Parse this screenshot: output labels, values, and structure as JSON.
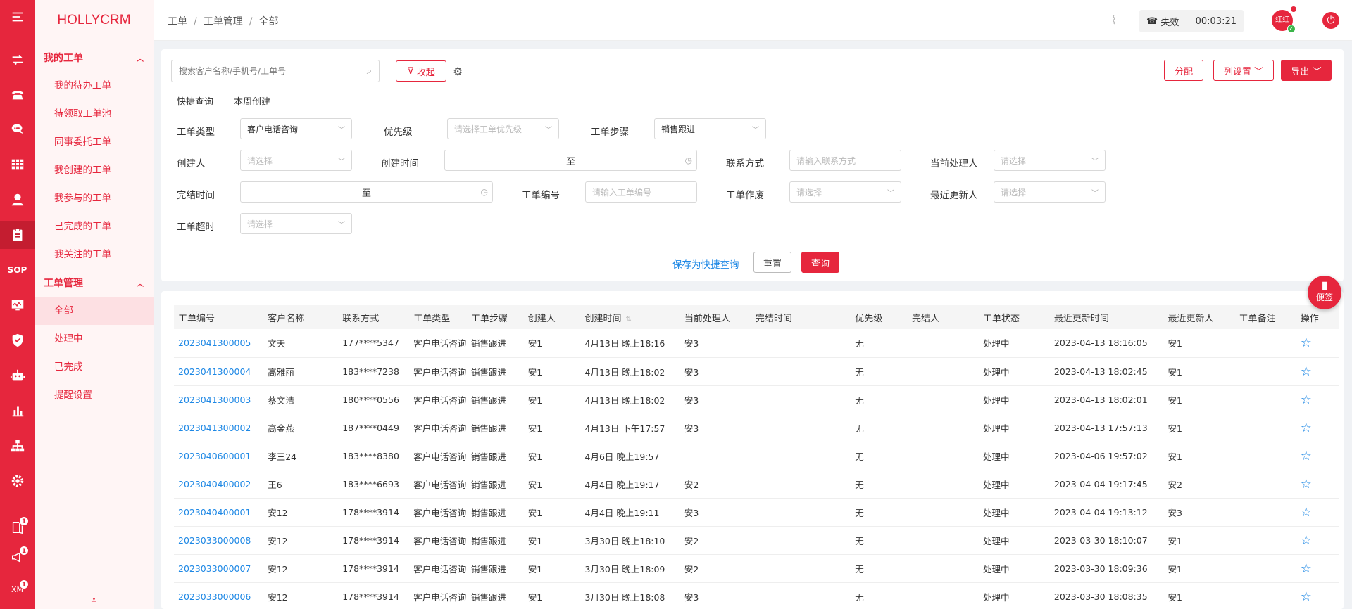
{
  "brand": "HOLLYCRM",
  "rail": {
    "items": [
      "menu-icon",
      "transfer-icon",
      "phone-icon",
      "chat-icon",
      "grid-icon",
      "user-icon",
      "clipboard-icon",
      "sop-text",
      "monitor-icon",
      "shield-icon",
      "robot-icon",
      "chart-icon",
      "org-icon",
      "gear-icon"
    ],
    "sop_label": "SOP",
    "bottom_badges": [
      "1",
      "1",
      "1"
    ],
    "xm_label": "XM"
  },
  "sidebar": {
    "group1": "我的工单",
    "group1_items": [
      "我的待办工单",
      "待领取工单池",
      "同事委托工单",
      "我创建的工单",
      "我参与的工单",
      "已完成的工单",
      "我关注的工单"
    ],
    "group2": "工单管理",
    "group2_items": [
      "全部",
      "处理中",
      "已完成",
      "提醒设置"
    ]
  },
  "topbar": {
    "breadcrumb": [
      "工单",
      "工单管理",
      "全部"
    ],
    "phone_status": "失效",
    "timer": "00:03:21",
    "avatar_text": "红红"
  },
  "filter": {
    "search_placeholder": "搜索客户名称/手机号/工单号",
    "collapse_label": "收起",
    "assign_label": "分配",
    "column_settings_label": "列设置",
    "export_label": "导出",
    "quick_query_label": "快捷查询",
    "quick_this_week": "本周创建",
    "labels": {
      "type": "工单类型",
      "priority": "优先级",
      "step": "工单步骤",
      "creator": "创建人",
      "created_time": "创建时间",
      "contact": "联系方式",
      "handler": "当前处理人",
      "finish_time": "完结时间",
      "number": "工单编号",
      "voided": "工单作废",
      "updater": "最近更新人",
      "overtime": "工单超时"
    },
    "values": {
      "type": "客户电话咨询",
      "priority_ph": "请选择工单优先级",
      "step": "销售跟进",
      "select_ph": "请选择",
      "contact_ph": "请输入联系方式",
      "number_ph": "请输入工单编号",
      "range_sep": "至"
    },
    "save_quick": "保存为快捷查询",
    "reset": "重置",
    "query": "查询"
  },
  "table": {
    "headers": [
      "工单编号",
      "客户名称",
      "联系方式",
      "工单类型",
      "工单步骤",
      "创建人",
      "创建时间",
      "当前处理人",
      "完结时间",
      "优先级",
      "完结人",
      "工单状态",
      "最近更新时间",
      "最近更新人",
      "工单备注",
      "操作"
    ],
    "rows": [
      [
        "2023041300005",
        "文天",
        "177****5347",
        "客户电话咨询",
        "销售跟进",
        "安1",
        "4月13日 晚上18:16",
        "安3",
        "",
        "无",
        "",
        "处理中",
        "2023-04-13 18:16:05",
        "安1",
        ""
      ],
      [
        "2023041300004",
        "高雅丽",
        "183****7238",
        "客户电话咨询",
        "销售跟进",
        "安1",
        "4月13日 晚上18:02",
        "安3",
        "",
        "无",
        "",
        "处理中",
        "2023-04-13 18:02:45",
        "安1",
        ""
      ],
      [
        "2023041300003",
        "蔡文浩",
        "180****0556",
        "客户电话咨询",
        "销售跟进",
        "安1",
        "4月13日 晚上18:02",
        "安3",
        "",
        "无",
        "",
        "处理中",
        "2023-04-13 18:02:01",
        "安1",
        ""
      ],
      [
        "2023041300002",
        "高金燕",
        "187****0449",
        "客户电话咨询",
        "销售跟进",
        "安1",
        "4月13日 下午17:57",
        "安3",
        "",
        "无",
        "",
        "处理中",
        "2023-04-13 17:57:13",
        "安1",
        ""
      ],
      [
        "2023040600001",
        "李三24",
        "183****8380",
        "客户电话咨询",
        "销售跟进",
        "安1",
        "4月6日 晚上19:57",
        "",
        "",
        "无",
        "",
        "处理中",
        "2023-04-06 19:57:02",
        "安1",
        ""
      ],
      [
        "2023040400002",
        "王6",
        "183****6693",
        "客户电话咨询",
        "销售跟进",
        "安1",
        "4月4日 晚上19:17",
        "安2",
        "",
        "无",
        "",
        "处理中",
        "2023-04-04 19:17:45",
        "安2",
        ""
      ],
      [
        "2023040400001",
        "安12",
        "178****3914",
        "客户电话咨询",
        "销售跟进",
        "安1",
        "4月4日 晚上19:11",
        "安3",
        "",
        "无",
        "",
        "处理中",
        "2023-04-04 19:13:12",
        "安3",
        ""
      ],
      [
        "2023033000008",
        "安12",
        "178****3914",
        "客户电话咨询",
        "销售跟进",
        "安1",
        "3月30日 晚上18:10",
        "安2",
        "",
        "无",
        "",
        "处理中",
        "2023-03-30 18:10:07",
        "安1",
        ""
      ],
      [
        "2023033000007",
        "安12",
        "178****3914",
        "客户电话咨询",
        "销售跟进",
        "安1",
        "3月30日 晚上18:09",
        "安2",
        "",
        "无",
        "",
        "处理中",
        "2023-03-30 18:09:36",
        "安1",
        ""
      ],
      [
        "2023033000006",
        "安12",
        "178****3914",
        "客户电话咨询",
        "销售跟进",
        "安1",
        "3月30日 晚上18:08",
        "安3",
        "",
        "无",
        "",
        "处理中",
        "2023-03-30 18:08:35",
        "安1",
        ""
      ]
    ]
  },
  "float_tag": "便签",
  "colors": {
    "accent": "#e6263d",
    "link": "#1e88e5"
  }
}
